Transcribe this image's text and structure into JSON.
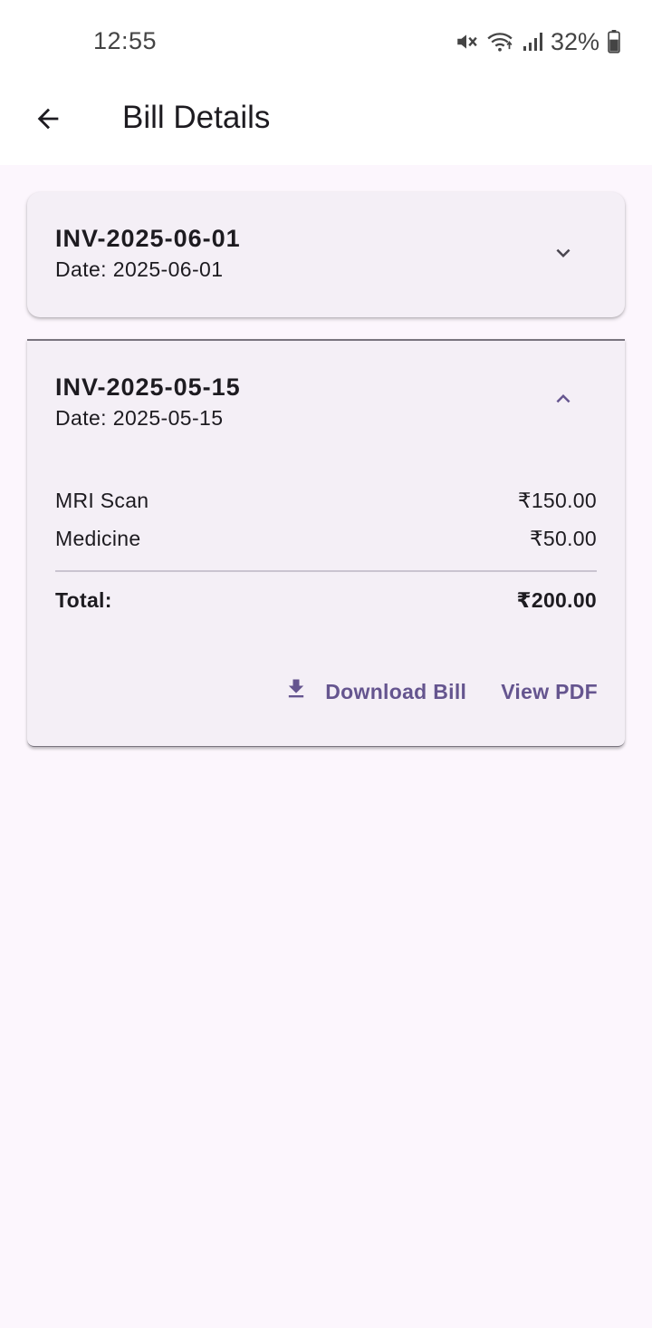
{
  "status_bar": {
    "time": "12:55",
    "battery": "32%",
    "icons": [
      "mute-icon",
      "wifi-icon",
      "signal-icon",
      "battery-icon"
    ]
  },
  "app_bar": {
    "back_icon": "arrow-left-icon",
    "title": "Bill Details"
  },
  "bills": [
    {
      "invoice": "INV-2025-06-01",
      "date": "Date: 2025-06-01",
      "expanded": false,
      "chevron_icon": "chevron-down-icon"
    },
    {
      "invoice": "INV-2025-05-15",
      "date": "Date: 2025-05-15",
      "expanded": true,
      "chevron_icon": "chevron-up-icon",
      "items": [
        {
          "name": "MRI Scan",
          "amount": "₹150.00"
        },
        {
          "name": "Medicine",
          "amount": "₹50.00"
        }
      ],
      "total_label": "Total:",
      "total_amount": "₹200.00",
      "download_label": "Download Bill",
      "download_icon": "download-icon",
      "view_pdf_label": "View PDF"
    }
  ],
  "colors": {
    "background": "#fcf6fd",
    "card": "#f4eff6",
    "accent": "#65558f",
    "text": "#1d1b20",
    "divider": "#cac4d0"
  }
}
